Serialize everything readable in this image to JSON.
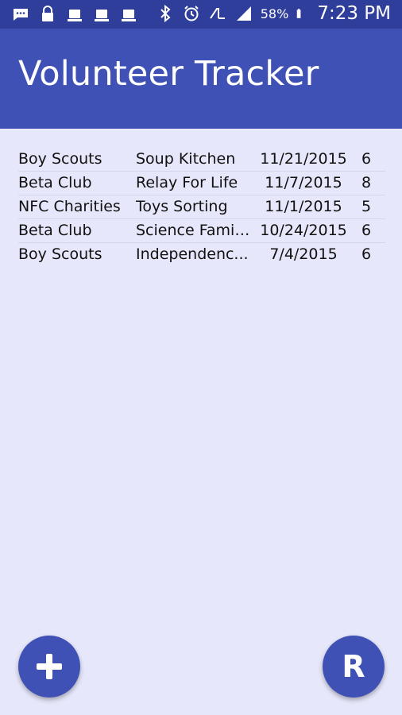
{
  "status_bar": {
    "battery_percent": "58%",
    "time": "7:23 PM"
  },
  "app": {
    "title": "Volunteer Tracker"
  },
  "entries": [
    {
      "org": "Boy Scouts",
      "event": "Soup Kitchen",
      "date": "11/21/2015",
      "hours": "6"
    },
    {
      "org": "Beta Club",
      "event": "Relay For Life",
      "date": "11/7/2015",
      "hours": "8"
    },
    {
      "org": "NFC Charities",
      "event": "Toys Sorting",
      "date": "11/1/2015",
      "hours": "5"
    },
    {
      "org": "Beta Club",
      "event": "Science Famil...",
      "date": "10/24/2015",
      "hours": "6"
    },
    {
      "org": "Boy Scouts",
      "event": "Independenc...",
      "date": "7/4/2015",
      "hours": "6"
    }
  ],
  "buttons": {
    "report_label": "R"
  },
  "icons": {
    "add": "plus-icon",
    "report": "letter-r"
  },
  "colors": {
    "primary": "#3f51b5",
    "primary_dark": "#2f3e9a",
    "background": "#e6e7fa"
  }
}
